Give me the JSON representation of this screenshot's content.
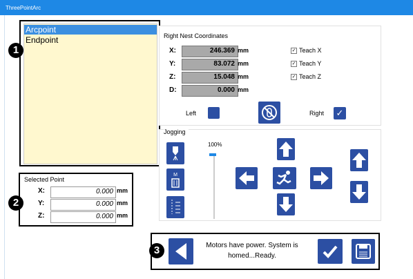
{
  "window": {
    "title": "ThreePointArc"
  },
  "callouts": [
    "1",
    "2",
    "3"
  ],
  "points_list": {
    "items": [
      "Arcpoint",
      "Endpoint"
    ],
    "selected_index": 0
  },
  "selected_point": {
    "title": "Selected Point",
    "rows": [
      {
        "label": "X:",
        "value": "0.000",
        "unit": "mm"
      },
      {
        "label": "Y:",
        "value": "0.000",
        "unit": "mm"
      },
      {
        "label": "Z:",
        "value": "0.000",
        "unit": "mm"
      }
    ]
  },
  "right_nest": {
    "title": "Right Nest Coordinates",
    "rows": [
      {
        "label": "X:",
        "value": "246.369",
        "unit": "mm",
        "teach": "Teach X"
      },
      {
        "label": "Y:",
        "value": "83.072",
        "unit": "mm",
        "teach": "Teach Y"
      },
      {
        "label": "Z:",
        "value": "15.048",
        "unit": "mm",
        "teach": "Teach Z"
      },
      {
        "label": "D:",
        "value": "0.000",
        "unit": "mm"
      }
    ],
    "teach_checked": [
      true,
      true,
      true
    ],
    "left_label": "Left",
    "right_label": "Right",
    "left_checked": false,
    "right_checked": true
  },
  "jogging": {
    "title": "Jogging",
    "speed_percent": "100%",
    "speed_level": 1.0
  },
  "status": {
    "message": "Motors have power. System is homed...Ready."
  },
  "colors": {
    "accent": "#2c4fa3",
    "title_bar": "#1e88e5",
    "list_bg": "#fff8cf",
    "list_selected": "#3b8fe0"
  }
}
